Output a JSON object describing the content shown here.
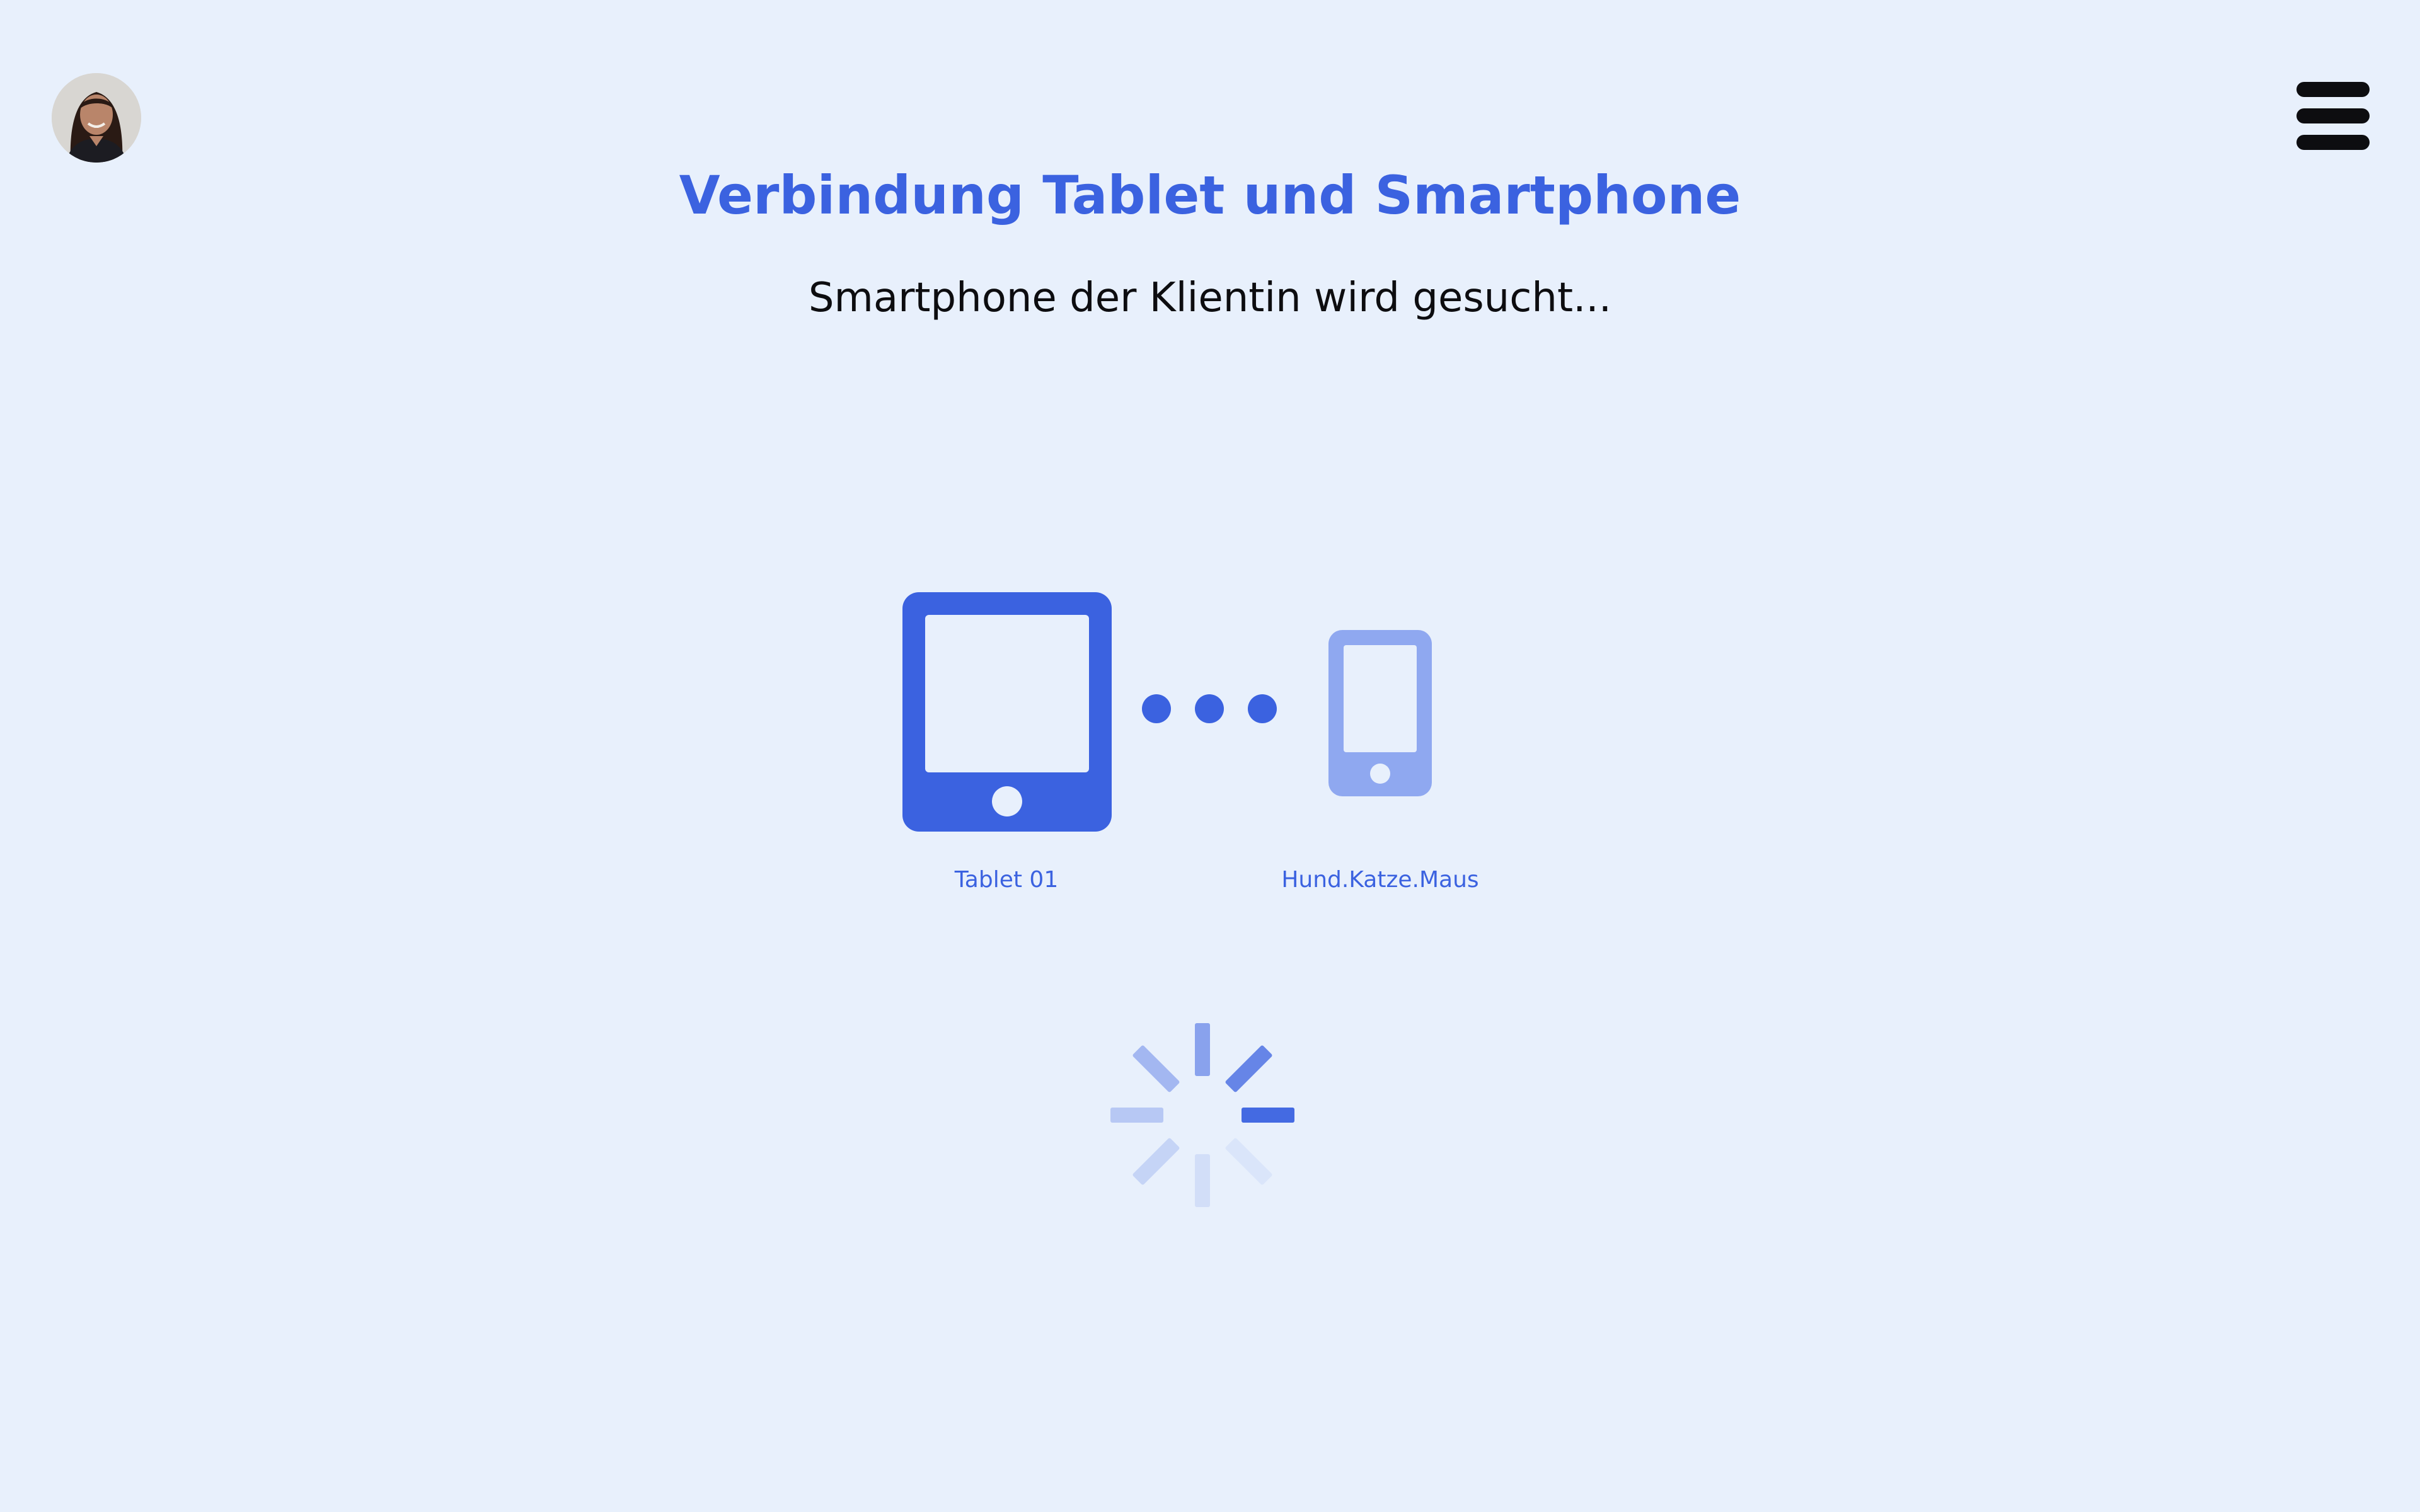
{
  "header": {
    "title": "Verbindung Tablet und Smartphone",
    "status": "Smartphone der Klientin wird gesucht..."
  },
  "user": {
    "avatar_icon": "user-avatar-photo"
  },
  "menu": {
    "icon": "hamburger-menu-icon"
  },
  "devices": {
    "tablet": {
      "label": "Tablet 01",
      "icon": "tablet-icon",
      "color": "#3b62e0"
    },
    "phone": {
      "label": "Hund.Katze.Maus",
      "icon": "smartphone-icon",
      "color": "#8fa8f0"
    },
    "connector": {
      "icon": "connecting-dots-icon",
      "color": "#3b62e0"
    }
  },
  "loading": {
    "icon": "loading-spinner-icon",
    "color": "#3b62e0"
  },
  "colors": {
    "background": "#e8f0fc",
    "accent": "#3b62e0",
    "text": "#0d0d10"
  }
}
